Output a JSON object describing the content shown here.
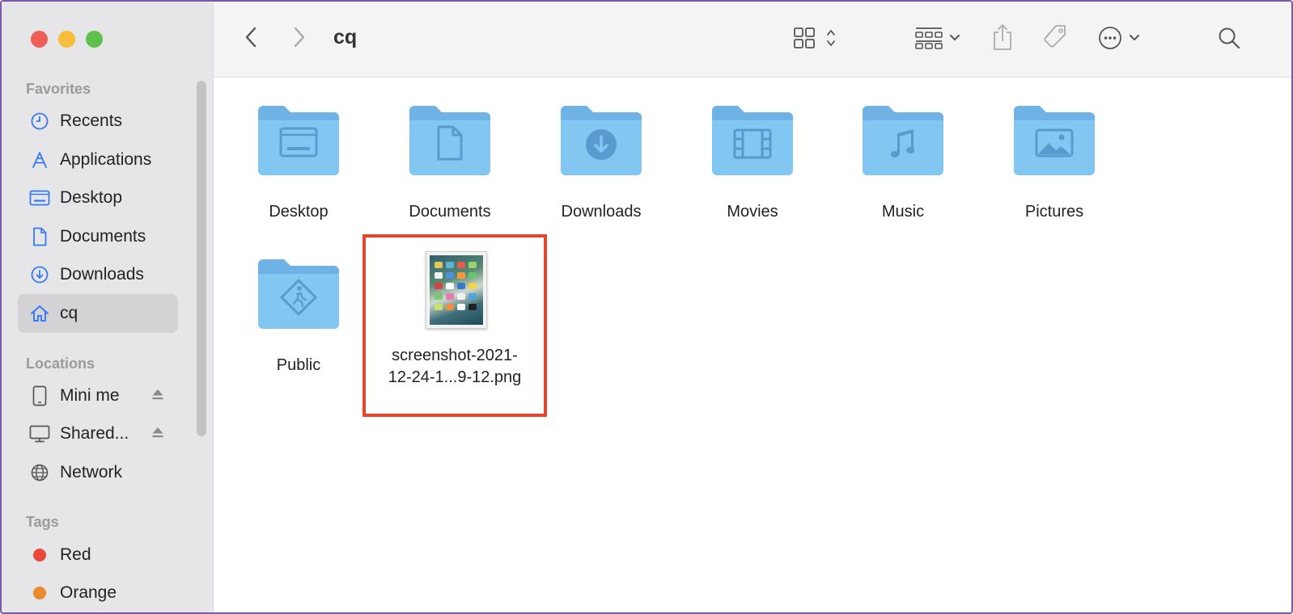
{
  "window": {
    "title": "cq"
  },
  "sidebar": {
    "favorites_heading": "Favorites",
    "favorites": [
      {
        "label": "Recents",
        "icon": "clock-icon"
      },
      {
        "label": "Applications",
        "icon": "applications-icon"
      },
      {
        "label": "Desktop",
        "icon": "desktop-icon"
      },
      {
        "label": "Documents",
        "icon": "document-icon"
      },
      {
        "label": "Downloads",
        "icon": "download-icon"
      },
      {
        "label": "cq",
        "icon": "home-icon",
        "selected": true
      }
    ],
    "locations_heading": "Locations",
    "locations": [
      {
        "label": "Mini me",
        "icon": "ipad-icon",
        "eject": true
      },
      {
        "label": "Shared...",
        "icon": "display-icon",
        "eject": true
      },
      {
        "label": "Network",
        "icon": "globe-icon"
      }
    ],
    "tags_heading": "Tags",
    "tags": [
      {
        "label": "Red",
        "color": "#e9483b"
      },
      {
        "label": "Orange",
        "color": "#e98a2e"
      }
    ]
  },
  "toolbar": {
    "back_icon": "chevron-left-icon",
    "forward_icon": "chevron-right-icon",
    "title": "cq",
    "view_icon": "icon-grid-view-icon",
    "group_icon": "group-by-icon",
    "share_icon": "share-icon",
    "tag_icon": "tag-icon",
    "more_icon": "more-actions-icon",
    "search_icon": "search-icon"
  },
  "content": {
    "folders": [
      {
        "label": "Desktop",
        "glyph": "desktop-glyph"
      },
      {
        "label": "Documents",
        "glyph": "document-glyph"
      },
      {
        "label": "Downloads",
        "glyph": "download-glyph"
      },
      {
        "label": "Movies",
        "glyph": "film-glyph"
      },
      {
        "label": "Music",
        "glyph": "music-glyph"
      },
      {
        "label": "Pictures",
        "glyph": "photo-glyph"
      },
      {
        "label": "Public",
        "glyph": "public-glyph"
      }
    ],
    "selected_file": {
      "label_line1": "screenshot-2021-",
      "label_line2": "12-24-1...9-12.png"
    }
  },
  "colors": {
    "accent": "#3478f6",
    "folder": "#7cc3f1",
    "selection_box": "#e5452f"
  }
}
